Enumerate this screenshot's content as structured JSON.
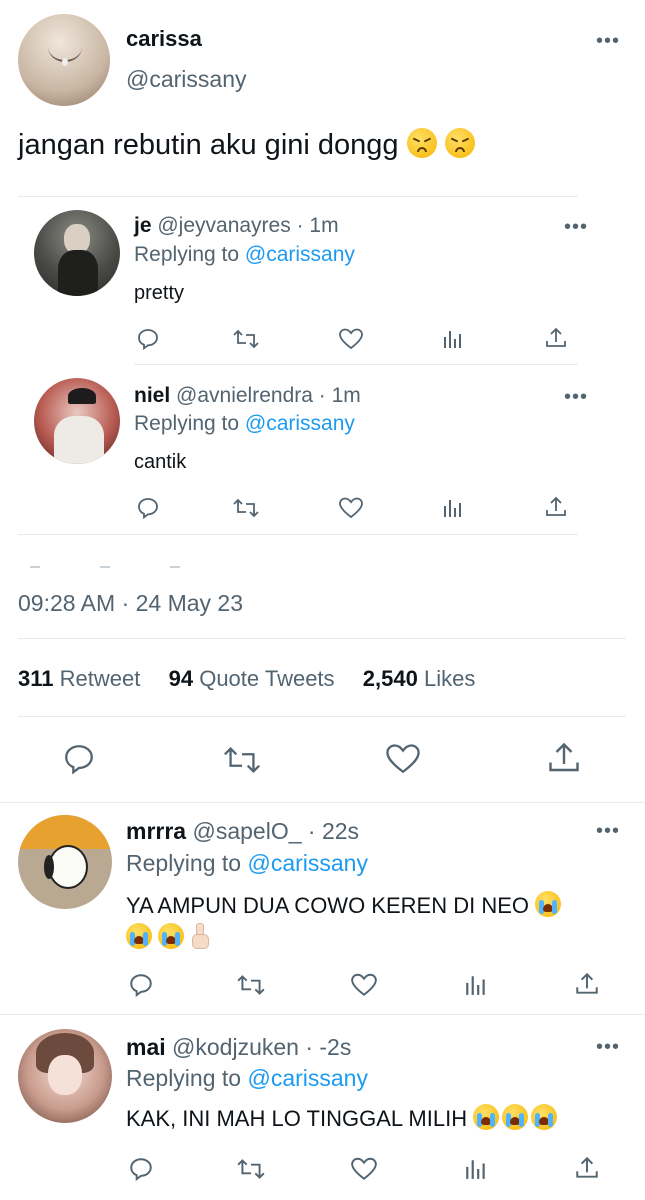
{
  "main_tweet": {
    "author_name": "carissa",
    "author_handle": "@carissany",
    "text": "jangan rebutin aku gini dongg",
    "emoji": [
      "tired-face",
      "tired-face"
    ],
    "timestamp": "09:28 AM · 24 May 23",
    "stats": {
      "retweets_count": "311",
      "retweets_label": "Retweet",
      "quotes_count": "94",
      "quotes_label": "Quote Tweets",
      "likes_count": "2,540",
      "likes_label": "Likes"
    }
  },
  "quoted_replies": [
    {
      "name": "je",
      "handle": "@jeyvanayres",
      "time": "· 1m",
      "replying_prefix": "Replying to",
      "replying_to": "@carissany",
      "text": "pretty"
    },
    {
      "name": "niel",
      "handle": "@avnielrendra",
      "time": "· 1m",
      "replying_prefix": "Replying to",
      "replying_to": "@carissany",
      "text": "cantik"
    }
  ],
  "replies": [
    {
      "name": "mrrra",
      "handle": "@sapelO_",
      "time": "· 22s",
      "replying_prefix": "Replying to",
      "replying_to": "@carissany",
      "text": "YA AMPUN DUA COWO KEREN DI NEO",
      "emoji": [
        "loudly-crying-face",
        "loudly-crying-face",
        "loudly-crying-face",
        "pointing-up"
      ]
    },
    {
      "name": "mai",
      "handle": "@kodjzuken",
      "time": "· -2s",
      "replying_prefix": "Replying to",
      "replying_to": "@carissany",
      "text": "KAK, INI MAH LO TINGGAL MILIH",
      "emoji": [
        "loudly-crying-face",
        "loudly-crying-face",
        "loudly-crying-face"
      ]
    }
  ],
  "icons": [
    "more-icon",
    "reply-icon",
    "retweet-icon",
    "like-icon",
    "views-icon",
    "share-icon"
  ],
  "colors": {
    "link": "#1d9bf0",
    "muted": "#536471",
    "text": "#0f1419",
    "divider": "#e6ecf0"
  }
}
